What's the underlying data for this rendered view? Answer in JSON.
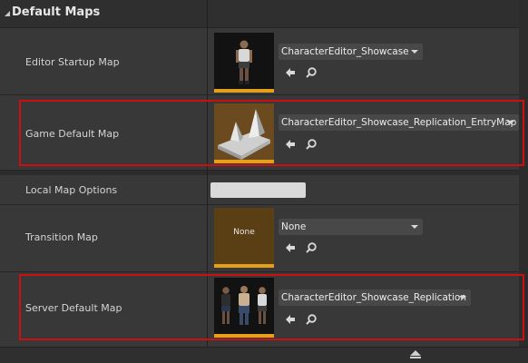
{
  "section": {
    "title": "Default Maps"
  },
  "rows": {
    "editor_startup": {
      "label": "Editor Startup Map",
      "value": "CharacterEditor_Showcase"
    },
    "game_default": {
      "label": "Game Default Map",
      "value": "CharacterEditor_Showcase_Replication_EntryMap"
    },
    "local_options": {
      "label": "Local Map Options",
      "value": ""
    },
    "transition": {
      "label": "Transition Map",
      "value": "None",
      "thumb_text": "None"
    },
    "server_default": {
      "label": "Server Default Map",
      "value": "CharacterEditor_Showcase_Replication"
    }
  },
  "colors": {
    "highlight": "#cc1010",
    "thumb_accent": "#e59f1a"
  },
  "icons": {
    "use_selected": "left-arrow-icon",
    "browse": "magnifier-icon",
    "expand": "chevron-down-icon",
    "collapse_section": "triangle-expanded-icon",
    "advanced": "chevron-up-icon"
  }
}
